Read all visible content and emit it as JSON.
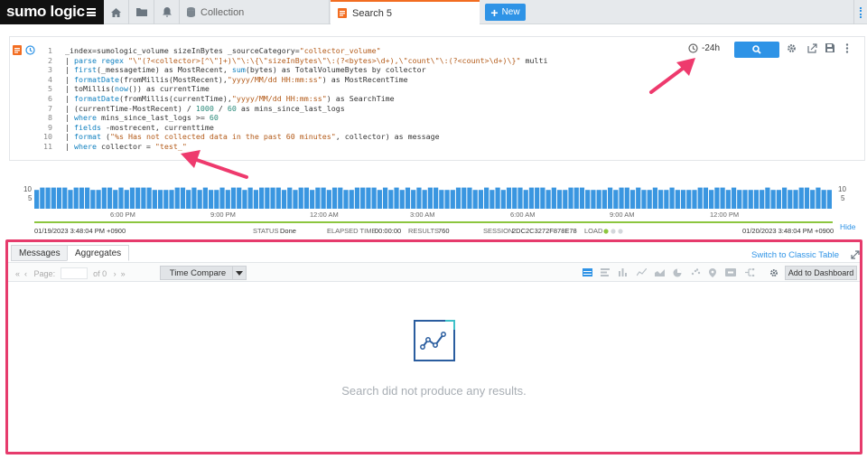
{
  "app": {
    "logo": "sumo logic"
  },
  "tabs": [
    {
      "label": "Collection"
    },
    {
      "label": "Search 5"
    }
  ],
  "new_button": "New",
  "query": {
    "lines": [
      {
        "num": "1",
        "parts": [
          {
            "t": "_index=sumologic_volume sizeInBytes _sourceCategory=",
            "c": "plain"
          },
          {
            "t": "\"collector_volume\"",
            "c": "str"
          }
        ]
      },
      {
        "num": "2",
        "parts": [
          {
            "t": "| ",
            "c": "plain"
          },
          {
            "t": "parse regex ",
            "c": "kw"
          },
          {
            "t": "\"\\\"(?<collector>[^\\\"]+)\\\"\\:\\{\\\"sizeInBytes\\\"\\:(?<bytes>\\d+),\\\"count\\\"\\:(?<count>\\d+)\\}\"",
            "c": "str"
          },
          {
            "t": " multi",
            "c": "plain"
          }
        ]
      },
      {
        "num": "3",
        "parts": [
          {
            "t": "| ",
            "c": "plain"
          },
          {
            "t": "first",
            "c": "kw"
          },
          {
            "t": "(_messagetime) as MostRecent, ",
            "c": "plain"
          },
          {
            "t": "sum",
            "c": "kw"
          },
          {
            "t": "(bytes) as TotalVolumeBytes by collector",
            "c": "plain"
          }
        ]
      },
      {
        "num": "4",
        "parts": [
          {
            "t": "| ",
            "c": "plain"
          },
          {
            "t": "formatDate",
            "c": "kw"
          },
          {
            "t": "(fromMillis(MostRecent),",
            "c": "plain"
          },
          {
            "t": "\"yyyy/MM/dd HH:mm:ss\"",
            "c": "str"
          },
          {
            "t": ") as MostRecentTime",
            "c": "plain"
          }
        ]
      },
      {
        "num": "5",
        "parts": [
          {
            "t": "| toMillis(",
            "c": "plain"
          },
          {
            "t": "now",
            "c": "kw"
          },
          {
            "t": "()) as currentTime",
            "c": "plain"
          }
        ]
      },
      {
        "num": "6",
        "parts": [
          {
            "t": "| ",
            "c": "plain"
          },
          {
            "t": "formatDate",
            "c": "kw"
          },
          {
            "t": "(fromMillis(currentTime),",
            "c": "plain"
          },
          {
            "t": "\"yyyy/MM/dd HH:mm:ss\"",
            "c": "str"
          },
          {
            "t": ") as SearchTime",
            "c": "plain"
          }
        ]
      },
      {
        "num": "7",
        "parts": [
          {
            "t": "| (currentTime-MostRecent) / ",
            "c": "plain"
          },
          {
            "t": "1000",
            "c": "num"
          },
          {
            "t": " / ",
            "c": "plain"
          },
          {
            "t": "60",
            "c": "num"
          },
          {
            "t": " as mins_since_last_logs",
            "c": "plain"
          }
        ]
      },
      {
        "num": "8",
        "parts": [
          {
            "t": "| ",
            "c": "plain"
          },
          {
            "t": "where",
            "c": "kw"
          },
          {
            "t": " mins_since_last_logs >= ",
            "c": "plain"
          },
          {
            "t": "60",
            "c": "num"
          }
        ]
      },
      {
        "num": "9",
        "parts": [
          {
            "t": "| ",
            "c": "plain"
          },
          {
            "t": "fields",
            "c": "kw"
          },
          {
            "t": " -mostrecent, currenttime",
            "c": "plain"
          }
        ]
      },
      {
        "num": "10",
        "parts": [
          {
            "t": "| ",
            "c": "plain"
          },
          {
            "t": "format",
            "c": "kw"
          },
          {
            "t": " (",
            "c": "plain"
          },
          {
            "t": "\"%s Has not collected data in the past 60 minutes\"",
            "c": "str"
          },
          {
            "t": ", collector) as message",
            "c": "plain"
          }
        ]
      },
      {
        "num": "11",
        "parts": [
          {
            "t": "| ",
            "c": "plain"
          },
          {
            "t": "where",
            "c": "kw"
          },
          {
            "t": " collector = ",
            "c": "plain"
          },
          {
            "t": "\"test_\"",
            "c": "str"
          }
        ]
      }
    ]
  },
  "time_range": "-24h",
  "histogram": {
    "y_max_label": "10",
    "y_mid_label": "5",
    "time_labels": [
      "6:00 PM",
      "9:00 PM",
      "12:00 AM",
      "3:00 AM",
      "6:00 AM",
      "9:00 AM",
      "12:00 PM"
    ],
    "start_time": "01/19/2023 3:48:04 PM +0900",
    "end_time": "01/20/2023 3:48:04 PM +0900",
    "bar_values": [
      8,
      9,
      9,
      9,
      9,
      9,
      8,
      9,
      9,
      9,
      8,
      8,
      9,
      9,
      8,
      9,
      8,
      9,
      9,
      9,
      9,
      8,
      8,
      8,
      8,
      9,
      9,
      8,
      9,
      8,
      9,
      8,
      8,
      9,
      8,
      9,
      9,
      8,
      9,
      8,
      9,
      9,
      9,
      9,
      8,
      9,
      8,
      9,
      9,
      8,
      9,
      9,
      8,
      9,
      9,
      8,
      8,
      9,
      9,
      9,
      9,
      8,
      9,
      8,
      9,
      8,
      9,
      8,
      9,
      8,
      9,
      9,
      8,
      8,
      8,
      9,
      9,
      9,
      8,
      8,
      9,
      8,
      9,
      8,
      9,
      9,
      9,
      8,
      9,
      9,
      9,
      8,
      9,
      8,
      8,
      9,
      9,
      9,
      8,
      8,
      8,
      8,
      9,
      8,
      9,
      9,
      8,
      9,
      8,
      8,
      9,
      8,
      8,
      9,
      8,
      8,
      8,
      8,
      9,
      9,
      8,
      9,
      9,
      8,
      9,
      8,
      8,
      8,
      8,
      8,
      9,
      8,
      8,
      9,
      8,
      8,
      9,
      9,
      8,
      9,
      8,
      8
    ]
  },
  "status": {
    "status_label": "STATUS",
    "status_value": "Done",
    "elapsed_label": "ELAPSED TIME",
    "elapsed_value": "00:00:00",
    "results_label": "RESULTS",
    "results_value": "760",
    "session_label": "SESSION",
    "session_value": "2DC2C3272F878E78",
    "load_label": "LOAD",
    "hide": "Hide"
  },
  "results": {
    "tabs": [
      "Messages",
      "Aggregates"
    ],
    "switch_link": "Switch to Classic Table",
    "page_label": "Page:",
    "of_label": "of 0",
    "time_compare": "Time Compare",
    "add_dashboard": "Add to Dashboard",
    "empty_message": "Search did not produce any results."
  }
}
